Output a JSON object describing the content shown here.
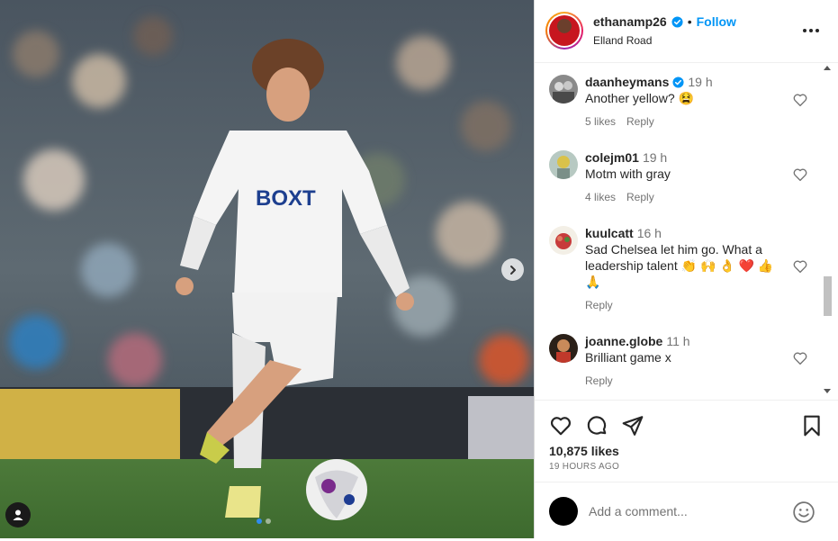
{
  "post": {
    "carousel": {
      "slides": 2,
      "active": 1
    }
  },
  "header": {
    "username": "ethanamp26",
    "separator": "•",
    "follow_label": "Follow",
    "location": "Elland Road"
  },
  "comments": [
    {
      "user": "daanheymans",
      "verified": true,
      "time": "19 h",
      "text": "Another yellow? 😫",
      "likes": "5 likes",
      "reply": "Reply"
    },
    {
      "user": "colejm01",
      "verified": false,
      "time": "19 h",
      "text": "Motm with gray",
      "likes": "4 likes",
      "reply": "Reply"
    },
    {
      "user": "kuulcatt",
      "verified": false,
      "time": "16 h",
      "text": "Sad Chelsea let him go. What a leadership talent 👏 🙌 👌 ❤️ 👍 🙏",
      "likes": "",
      "reply": "Reply"
    },
    {
      "user": "joanne.globe",
      "verified": false,
      "time": "11 h",
      "text": "Brilliant game x",
      "likes": "",
      "reply": "Reply"
    }
  ],
  "actions": {
    "likes": "10,875 likes",
    "time_ago": "19 HOURS AGO"
  },
  "add_comment": {
    "placeholder": "Add a comment..."
  },
  "colors": {
    "accent": "#0095f6",
    "text": "#262626",
    "muted": "#737373",
    "heart_red": "#e8243a"
  }
}
